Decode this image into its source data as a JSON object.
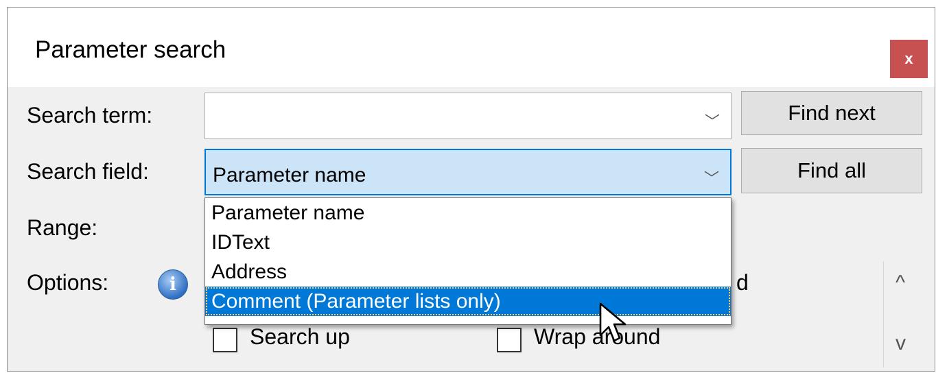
{
  "window": {
    "title": "Parameter search",
    "close_label": "x"
  },
  "labels": {
    "search_term": "Search term:",
    "search_field": "Search field:",
    "range": "Range:",
    "options": "Options:"
  },
  "search_term": {
    "value": ""
  },
  "search_field": {
    "value": "Parameter name",
    "options": [
      "Parameter name",
      "IDText",
      "Address",
      "Comment (Parameter lists only)"
    ],
    "highlighted": "Comment (Parameter lists only)"
  },
  "buttons": {
    "find_next": "Find next",
    "find_all": "Find all"
  },
  "options": {
    "search_up": {
      "label": "Search up",
      "checked": false
    },
    "wrap_around": {
      "label": "Wrap around",
      "checked": false
    },
    "partially_hidden_text": "d"
  },
  "icons": {
    "info": "i",
    "chevron": "﹀",
    "scroll_up": "^",
    "scroll_down": "v"
  },
  "colors": {
    "close": "#c75050",
    "accent": "#0078d7",
    "combo_focus": "#cce4f7"
  }
}
